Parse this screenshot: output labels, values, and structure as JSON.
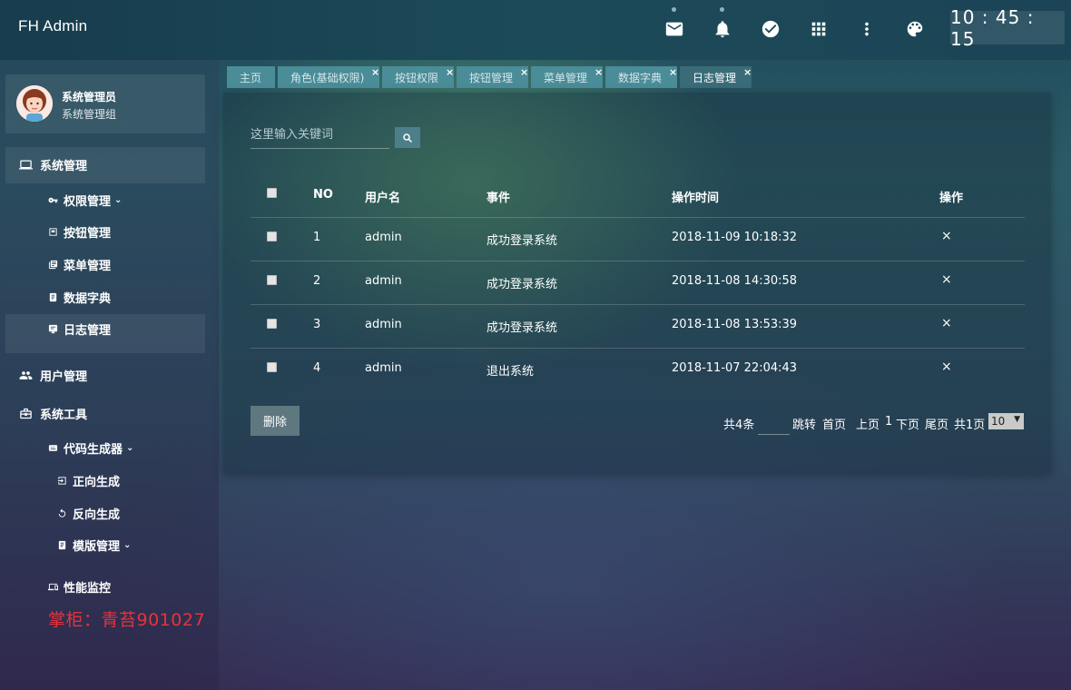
{
  "header": {
    "app_title": "FH Admin",
    "clock": "10 : 45 : 15",
    "icons": [
      "mail-icon",
      "bell-icon",
      "check-circle-icon",
      "apps-grid-icon",
      "more-vert-icon",
      "palette-icon"
    ]
  },
  "user": {
    "name": "系统管理员",
    "group": "系统管理组"
  },
  "sidebar": {
    "items": [
      {
        "label": "系统管理",
        "icon": "laptop-icon"
      },
      {
        "label": "权限管理",
        "icon": "key-icon"
      },
      {
        "label": "按钮管理",
        "icon": "button-icon"
      },
      {
        "label": "菜单管理",
        "icon": "menu-icon"
      },
      {
        "label": "数据字典",
        "icon": "book-icon"
      },
      {
        "label": "日志管理",
        "icon": "log-icon"
      },
      {
        "label": "用户管理",
        "icon": "users-icon"
      },
      {
        "label": "系统工具",
        "icon": "toolbox-icon"
      },
      {
        "label": "代码生成器",
        "icon": "code-icon"
      },
      {
        "label": "正向生成",
        "icon": "forward-icon"
      },
      {
        "label": "反向生成",
        "icon": "reverse-icon"
      },
      {
        "label": "模版管理",
        "icon": "template-icon"
      },
      {
        "label": "性能监控",
        "icon": "monitor-icon"
      }
    ],
    "watermark": "掌柜：青苔901027"
  },
  "tabs": [
    {
      "label": "主页",
      "closable": false
    },
    {
      "label": "角色(基础权限)",
      "closable": true
    },
    {
      "label": "按钮权限",
      "closable": true
    },
    {
      "label": "按钮管理",
      "closable": true
    },
    {
      "label": "菜单管理",
      "closable": true
    },
    {
      "label": "数据字典",
      "closable": true
    },
    {
      "label": "日志管理",
      "closable": true,
      "active": true
    }
  ],
  "tab_close_glyph": "×",
  "search": {
    "placeholder": "这里输入关键词"
  },
  "table": {
    "headers": [
      "NO",
      "用户名",
      "事件",
      "操作时间",
      "操作"
    ],
    "rows": [
      {
        "no": "1",
        "user": "admin",
        "event": "成功登录系统",
        "time": "2018-11-09 10:18:32",
        "action": "×"
      },
      {
        "no": "2",
        "user": "admin",
        "event": "成功登录系统",
        "time": "2018-11-08 14:30:58",
        "action": "×"
      },
      {
        "no": "3",
        "user": "admin",
        "event": "成功登录系统",
        "time": "2018-11-08 13:53:39",
        "action": "×"
      },
      {
        "no": "4",
        "user": "admin",
        "event": "退出系统",
        "time": "2018-11-07 22:04:43",
        "action": "×"
      }
    ]
  },
  "actions": {
    "delete_label": "删除"
  },
  "pager": {
    "total": "共4条",
    "jump": "跳转",
    "first": "首页",
    "prev": "上页",
    "current": "1",
    "next": "下页",
    "last": "尾页",
    "pages": "共1页",
    "page_size": "10"
  }
}
